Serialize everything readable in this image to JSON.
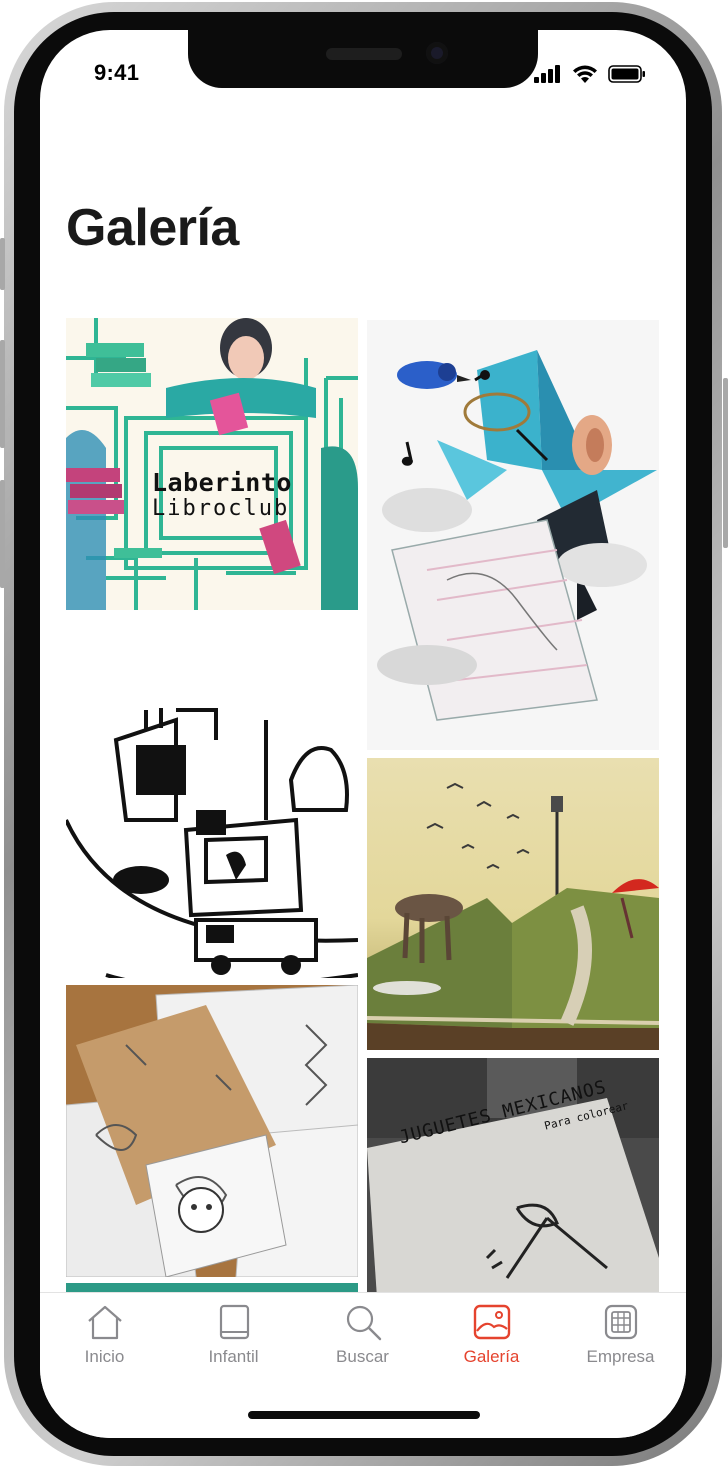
{
  "status_bar": {
    "time": "9:41"
  },
  "header": {
    "title": "Galería"
  },
  "gallery": {
    "laberinto": {
      "line1": "Laberinto",
      "line2": "Libroclub"
    },
    "juguetes": {
      "line1": "JUGUETES MEXICANOS",
      "line2": "Para colorear"
    }
  },
  "tab_bar": {
    "items": [
      {
        "label": "Inicio",
        "icon": "house-icon"
      },
      {
        "label": "Infantil",
        "icon": "book-icon"
      },
      {
        "label": "Buscar",
        "icon": "search-icon"
      },
      {
        "label": "Galería",
        "icon": "image-icon",
        "active": true
      },
      {
        "label": "Empresa",
        "icon": "building-icon"
      }
    ],
    "active_color": "#e5432e",
    "inactive_color": "#8a8a8e"
  }
}
